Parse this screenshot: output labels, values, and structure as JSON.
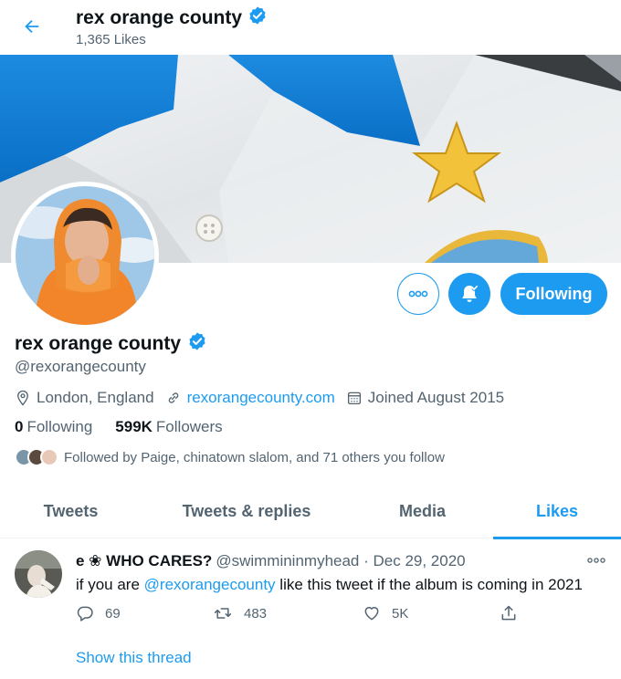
{
  "header": {
    "title": "rex orange county",
    "likes_count": "1,365 Likes"
  },
  "buttons": {
    "following_label": "Following"
  },
  "profile": {
    "display_name": "rex orange county",
    "handle": "@rexorangecounty",
    "location": "London, England",
    "website": "rexorangecounty.com",
    "joined": "Joined August 2015",
    "following_count": "0",
    "following_label": "Following",
    "followers_count": "599K",
    "followers_label": "Followers",
    "followed_by": "Followed by Paige, chinatown slalom, and 71 others you follow"
  },
  "tabs": [
    {
      "label": "Tweets"
    },
    {
      "label": "Tweets & replies"
    },
    {
      "label": "Media"
    },
    {
      "label": "Likes"
    }
  ],
  "tweet": {
    "display_name": "e ❀ WHO CARES?",
    "handle": "@swimmininmyhead",
    "separator": " · ",
    "date": "Dec 29, 2020",
    "text_before": "if you are ",
    "mention": "@rexorangecounty",
    "text_after": " like this tweet if the album is coming in 2021",
    "replies": "69",
    "retweets": "483",
    "likes": "5K",
    "show_thread": "Show this thread"
  },
  "colors": {
    "accent": "#1d9bf0",
    "muted": "#536471"
  }
}
